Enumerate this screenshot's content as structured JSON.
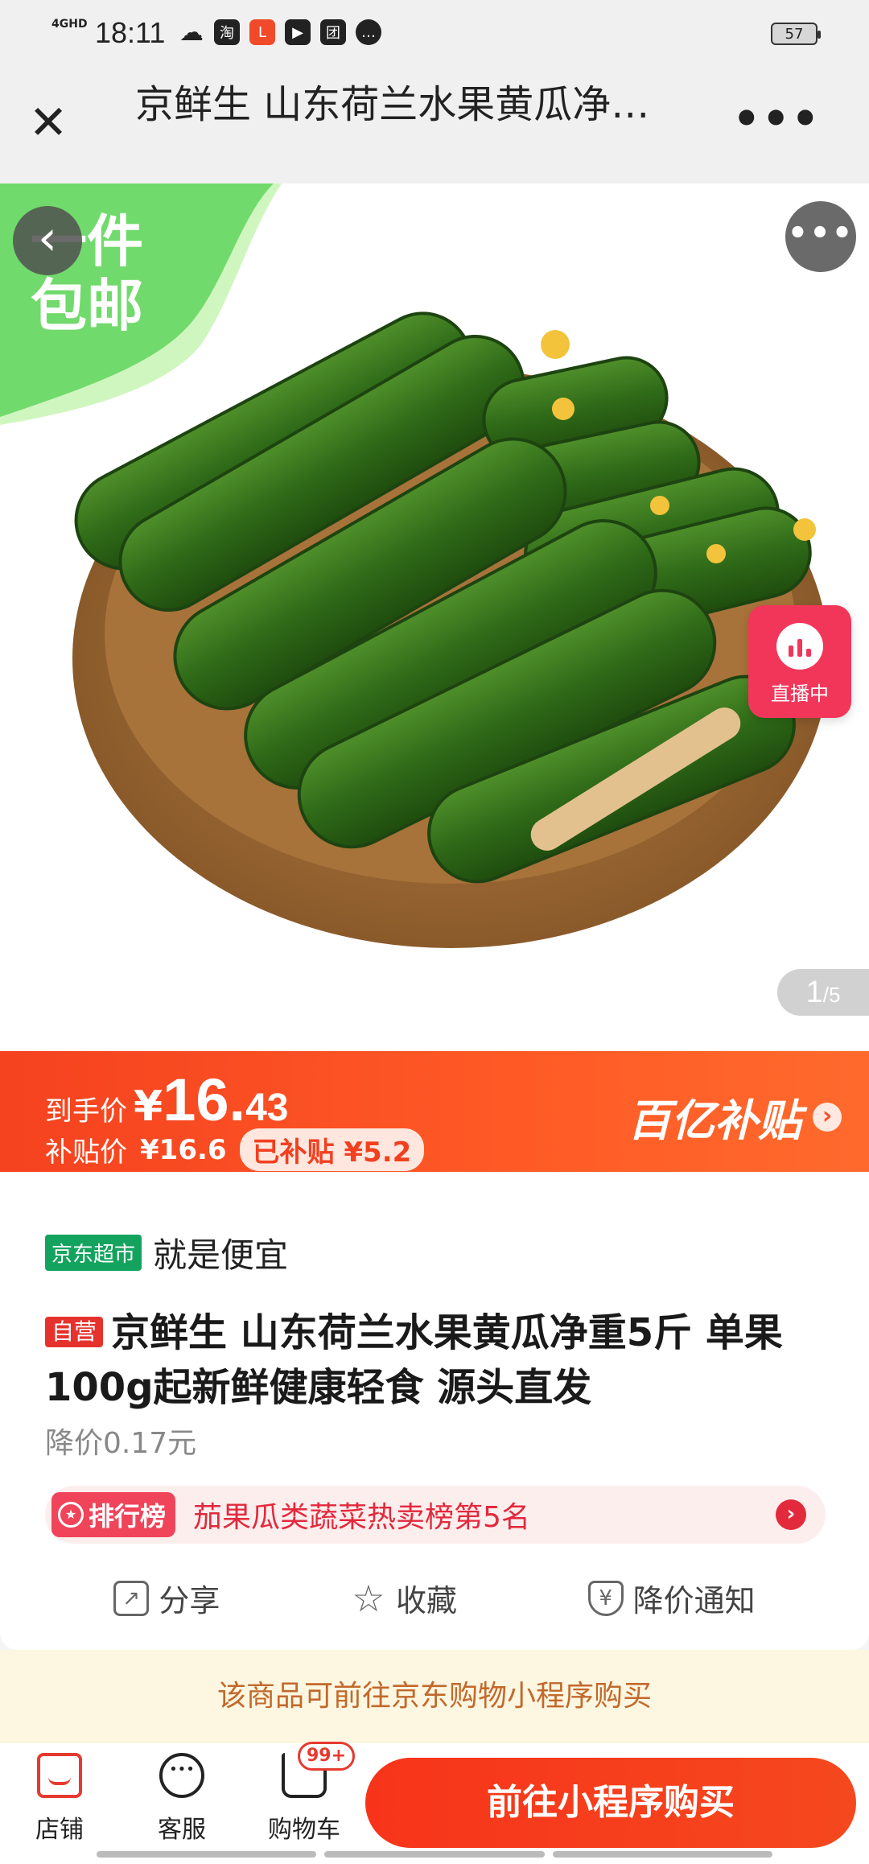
{
  "status_bar": {
    "network": "4GHD",
    "time": "18:11",
    "battery": "57",
    "app_icons": [
      "cloud-icon",
      "taobao-icon",
      "lazada-icon",
      "video-icon",
      "tuan-icon",
      "chat-icon"
    ]
  },
  "header": {
    "title": "京鲜生 山东荷兰水果黄瓜净…"
  },
  "hero": {
    "promo_text_line1": "一件",
    "promo_text_line2": "包邮",
    "live_label": "直播中",
    "pager_current": "1",
    "pager_total": "/5"
  },
  "price": {
    "final_label": "到手价",
    "currency": "¥",
    "final_int": "16.",
    "final_dec": "43",
    "subsidy_label": "补贴价",
    "subsidy_price": "¥16.6",
    "subsidy_pill": "已补贴 ¥5.2",
    "campaign": "百亿补贴"
  },
  "product": {
    "store_tag": "京东超市",
    "slogan": "就是便宜",
    "self_tag": "自营",
    "title": "京鲜生 山东荷兰水果黄瓜净重5斤 单果100g起新鲜健康轻食 源头直发",
    "price_drop": "降价0.17元"
  },
  "ranking": {
    "tag": "排行榜",
    "text": "茄果瓜类蔬菜热卖榜第5名"
  },
  "actions": {
    "share": "分享",
    "favorite": "收藏",
    "price_alert": "降价通知"
  },
  "notice": "该商品可前往京东购物小程序购买",
  "bottom_bar": {
    "shop": "店铺",
    "service": "客服",
    "cart": "购物车",
    "cart_badge": "99+",
    "buy_button": "前往小程序购买"
  },
  "colors": {
    "accent_red": "#f5421f",
    "store_green": "#14a35e",
    "live_pink": "#f2365a",
    "notice_text": "#c2692c"
  }
}
